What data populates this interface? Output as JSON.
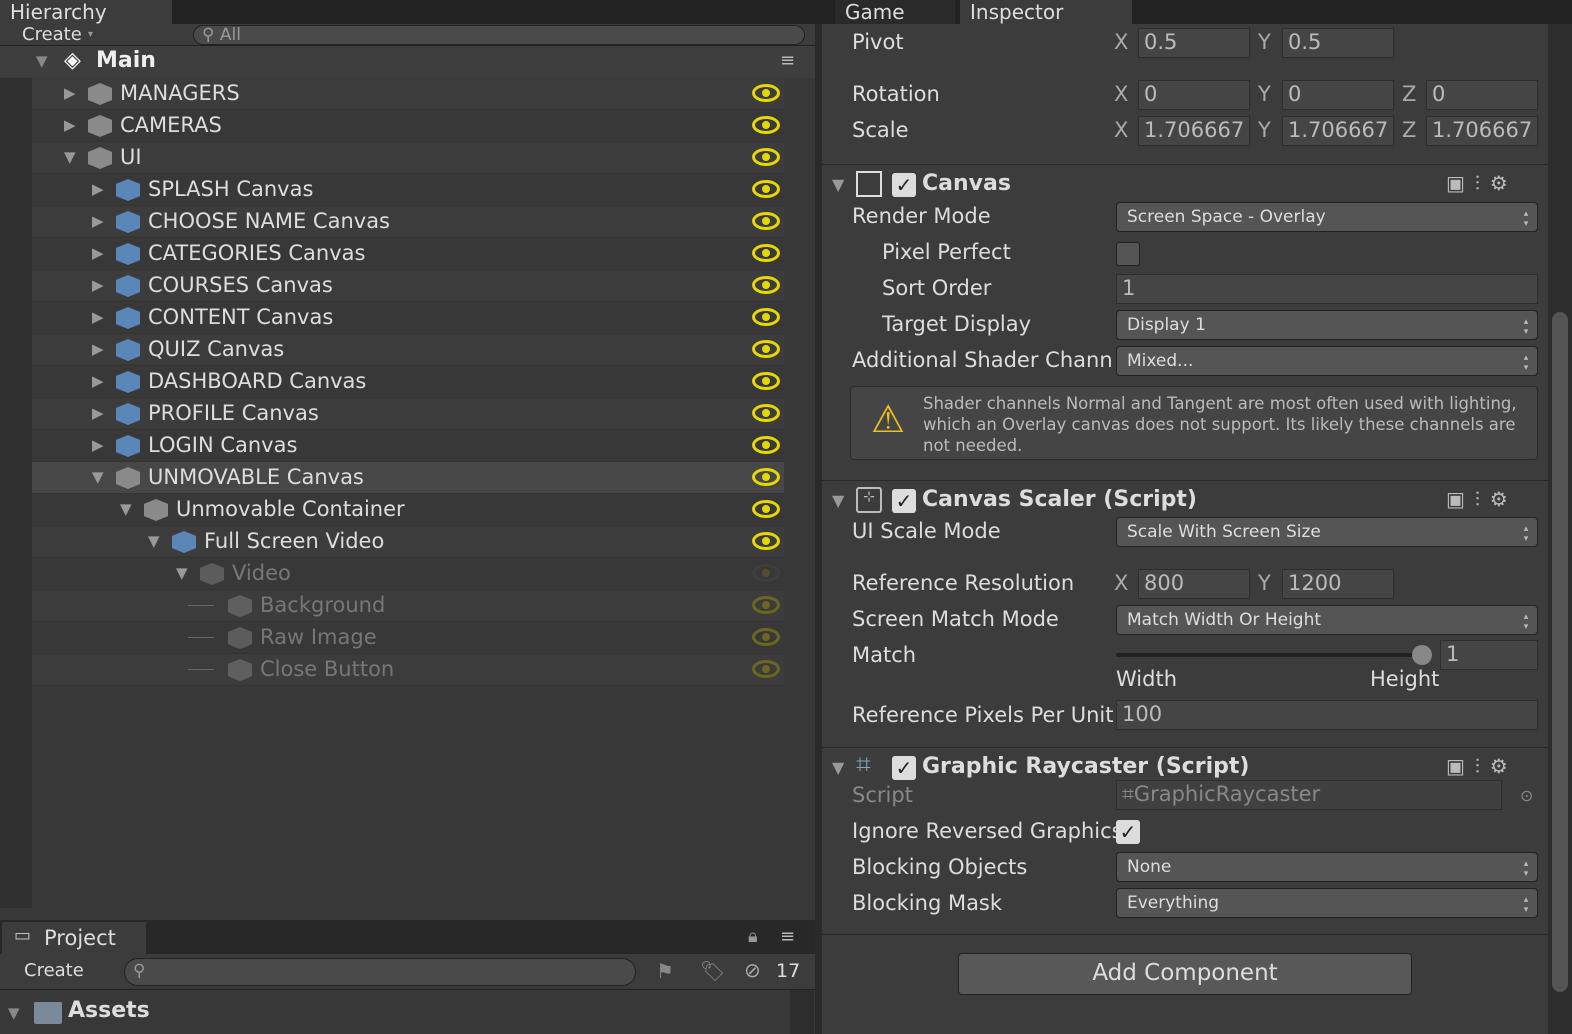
{
  "tabs": {
    "hierarchy": "Hierarchy",
    "game": "Game",
    "inspector": "Inspector"
  },
  "hierarchy": {
    "create": "Create",
    "search_placeholder": "All",
    "scene": "Main",
    "rows": [
      {
        "label": "MANAGERS",
        "depth": 1,
        "expanded": false,
        "prefab": false,
        "visible": true,
        "active": true
      },
      {
        "label": "CAMERAS",
        "depth": 1,
        "expanded": false,
        "prefab": false,
        "visible": true,
        "active": true
      },
      {
        "label": "UI",
        "depth": 1,
        "expanded": true,
        "prefab": false,
        "visible": true,
        "active": true
      },
      {
        "label": "SPLASH Canvas",
        "depth": 2,
        "expanded": false,
        "prefab": true,
        "visible": true,
        "active": true
      },
      {
        "label": "CHOOSE NAME Canvas",
        "depth": 2,
        "expanded": false,
        "prefab": true,
        "visible": true,
        "active": true
      },
      {
        "label": "CATEGORIES Canvas",
        "depth": 2,
        "expanded": false,
        "prefab": true,
        "visible": true,
        "active": true
      },
      {
        "label": "COURSES Canvas",
        "depth": 2,
        "expanded": false,
        "prefab": true,
        "visible": true,
        "active": true
      },
      {
        "label": "CONTENT Canvas",
        "depth": 2,
        "expanded": false,
        "prefab": true,
        "visible": true,
        "active": true
      },
      {
        "label": "QUIZ Canvas",
        "depth": 2,
        "expanded": false,
        "prefab": true,
        "visible": true,
        "active": true
      },
      {
        "label": "DASHBOARD Canvas",
        "depth": 2,
        "expanded": false,
        "prefab": true,
        "visible": true,
        "active": true
      },
      {
        "label": "PROFILE Canvas",
        "depth": 2,
        "expanded": false,
        "prefab": true,
        "visible": true,
        "active": true
      },
      {
        "label": "LOGIN Canvas",
        "depth": 2,
        "expanded": false,
        "prefab": true,
        "visible": true,
        "active": true
      },
      {
        "label": "UNMOVABLE Canvas",
        "depth": 2,
        "expanded": true,
        "prefab": false,
        "visible": true,
        "active": true,
        "selected": true
      },
      {
        "label": "Unmovable Container",
        "depth": 3,
        "expanded": true,
        "prefab": false,
        "visible": true,
        "active": true
      },
      {
        "label": "Full Screen Video",
        "depth": 4,
        "expanded": true,
        "prefab": true,
        "visible": true,
        "active": true
      },
      {
        "label": "Video",
        "depth": 5,
        "expanded": true,
        "prefab": false,
        "visible": false,
        "active": false
      },
      {
        "label": "Background",
        "depth": 6,
        "prefab": false,
        "visible": true,
        "active": false
      },
      {
        "label": "Raw Image",
        "depth": 6,
        "prefab": false,
        "visible": true,
        "active": false
      },
      {
        "label": "Close Button",
        "depth": 6,
        "prefab": false,
        "visible": true,
        "active": false
      }
    ]
  },
  "project": {
    "tab": "Project",
    "create": "Create",
    "search_placeholder": "",
    "hidden_count": "17",
    "root": "Assets"
  },
  "inspector": {
    "pivot": {
      "label": "Pivot",
      "x": "0.5",
      "y": "0.5"
    },
    "rotation": {
      "label": "Rotation",
      "x": "0",
      "y": "0",
      "z": "0"
    },
    "scale": {
      "label": "Scale",
      "x": "1.706667",
      "y": "1.706667",
      "z": "1.706667"
    },
    "axes": {
      "x": "X",
      "y": "Y",
      "z": "Z"
    },
    "canvas": {
      "title": "Canvas",
      "render_mode_label": "Render Mode",
      "render_mode": "Screen Space - Overlay",
      "pixel_perfect_label": "Pixel Perfect",
      "sort_order_label": "Sort Order",
      "sort_order": "1",
      "target_display_label": "Target Display",
      "target_display": "Display 1",
      "shader_label": "Additional Shader Chann",
      "shader": "Mixed...",
      "warning": "Shader channels Normal and Tangent are most often used with lighting, which an Overlay canvas does not support. Its likely these channels are not needed."
    },
    "scaler": {
      "title": "Canvas Scaler (Script)",
      "ui_scale_label": "UI Scale Mode",
      "ui_scale": "Scale With Screen Size",
      "ref_res_label": "Reference Resolution",
      "ref_x": "800",
      "ref_y": "1200",
      "match_mode_label": "Screen Match Mode",
      "match_mode": "Match Width Or Height",
      "match_label": "Match",
      "match": "1",
      "width_label": "Width",
      "height_label": "Height",
      "ppu_label": "Reference Pixels Per Unit",
      "ppu": "100"
    },
    "raycaster": {
      "title": "Graphic Raycaster (Script)",
      "script_label": "Script",
      "script": "GraphicRaycaster",
      "ignore_label": "Ignore Reversed Graphics",
      "blocking_objects_label": "Blocking Objects",
      "blocking_objects": "None",
      "blocking_mask_label": "Blocking Mask",
      "blocking_mask": "Everything"
    },
    "add_component": "Add Component"
  },
  "colors": {
    "eye": "#e6d800",
    "prefab": "#5b86b8",
    "panel": "#3c3c3c"
  }
}
